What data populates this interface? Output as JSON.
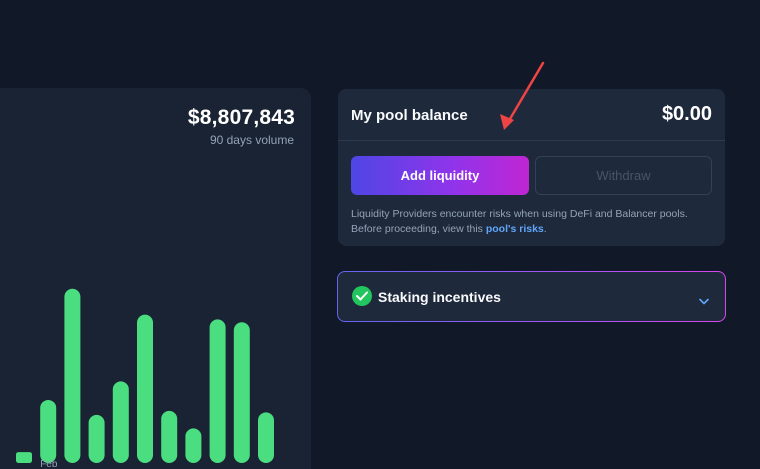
{
  "volume": {
    "value": "$8,807,843",
    "label": "90 days volume"
  },
  "chart_data": {
    "type": "bar",
    "categories": [
      "",
      "",
      "",
      "",
      "",
      "",
      "",
      "",
      "",
      "",
      "",
      "",
      ""
    ],
    "values": [
      0.8,
      15.1,
      45.6,
      11.0,
      20.2,
      38.5,
      12.1,
      7.3,
      37.2,
      36.4,
      11.7,
      0,
      0
    ],
    "x_tick_labels": [
      {
        "category_index": 1,
        "text": "Feb"
      }
    ],
    "color": "#4ade80",
    "ylim": [
      0,
      48
    ],
    "grid": false
  },
  "pool": {
    "title": "My pool balance",
    "amount": "$0.00",
    "add_liquidity_label": "Add liquidity",
    "withdraw_label": "Withdraw",
    "note_text": "Liquidity Providers encounter risks when using DeFi and Balancer pools. Before proceeding, view this ",
    "risk_link_text": "pool's risks",
    "note_end": "."
  },
  "staking": {
    "label": "Staking incentives"
  },
  "colors": {
    "background": "#111827",
    "card": "#1e293b",
    "accent_start": "#4f46e5",
    "accent_end": "#c026d3",
    "bar": "#4ade80",
    "link": "#60a5fa",
    "annotation_arrow": "#ef4444"
  },
  "icons": {
    "staking_status": "check-circle-icon",
    "staking_toggle": "chevron-down-icon"
  }
}
